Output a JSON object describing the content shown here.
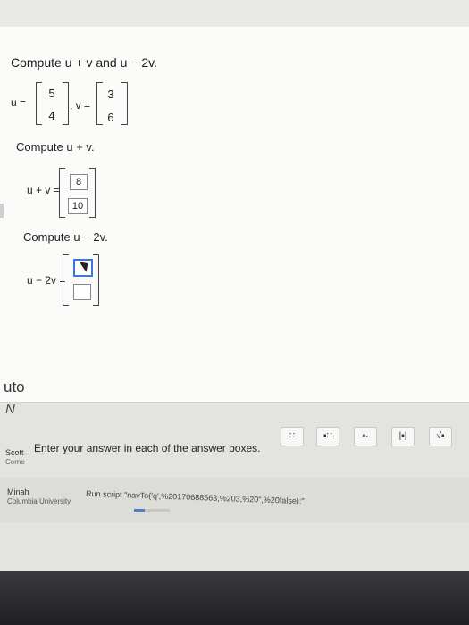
{
  "problem": {
    "title": "Compute u + v and u − 2v.",
    "u_label": "u =",
    "u": [
      "5",
      "4"
    ],
    "v_label": ", v =",
    "v": [
      "3",
      "6"
    ]
  },
  "part1": {
    "prompt": "Compute u + v.",
    "label": "u + v =",
    "answers": [
      "8",
      "10"
    ]
  },
  "part2": {
    "prompt": "Compute u − 2v.",
    "label": "u − 2v =",
    "answers": [
      "",
      ""
    ]
  },
  "side_text": {
    "uto": "uto",
    "n": "N"
  },
  "toolbar": {
    "tools": [
      "∷",
      "▪∷",
      "▪·",
      "|▪|",
      "√▪"
    ]
  },
  "instructions": "Enter your answer in each of the answer boxes.",
  "footer": {
    "scott": "Scott",
    "corne": "Corne",
    "minah": "Minah",
    "columbia": "Columbia University",
    "run_script": "Run script \"navTo('q',%20170688563,%203,%20\",%20false);\""
  },
  "progress_fraction": 0.3
}
